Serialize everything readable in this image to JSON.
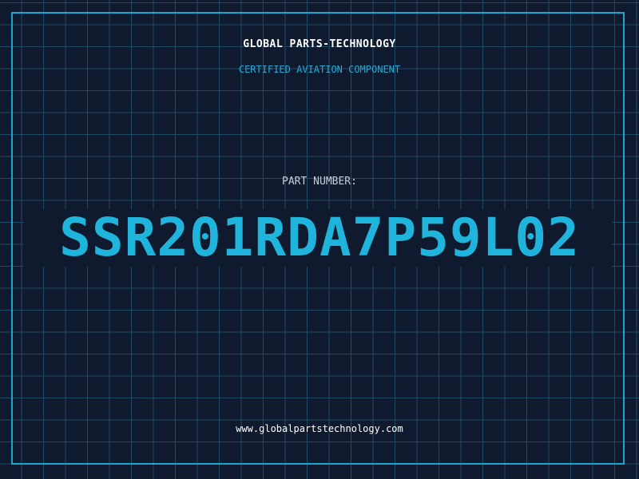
{
  "label": {
    "company": "GLOBAL PARTS-TECHNOLOGY",
    "subtitle": "CERTIFIED AVIATION COMPONENT",
    "part_number_label": "PART NUMBER:",
    "part_number": "SSR201RDA7P59L02",
    "website": "www.globalpartstechnology.com"
  },
  "colors": {
    "background": "#101a2e",
    "grid": "#1f4a66",
    "accent": "#1fb4dc",
    "text": "#ffffff"
  }
}
